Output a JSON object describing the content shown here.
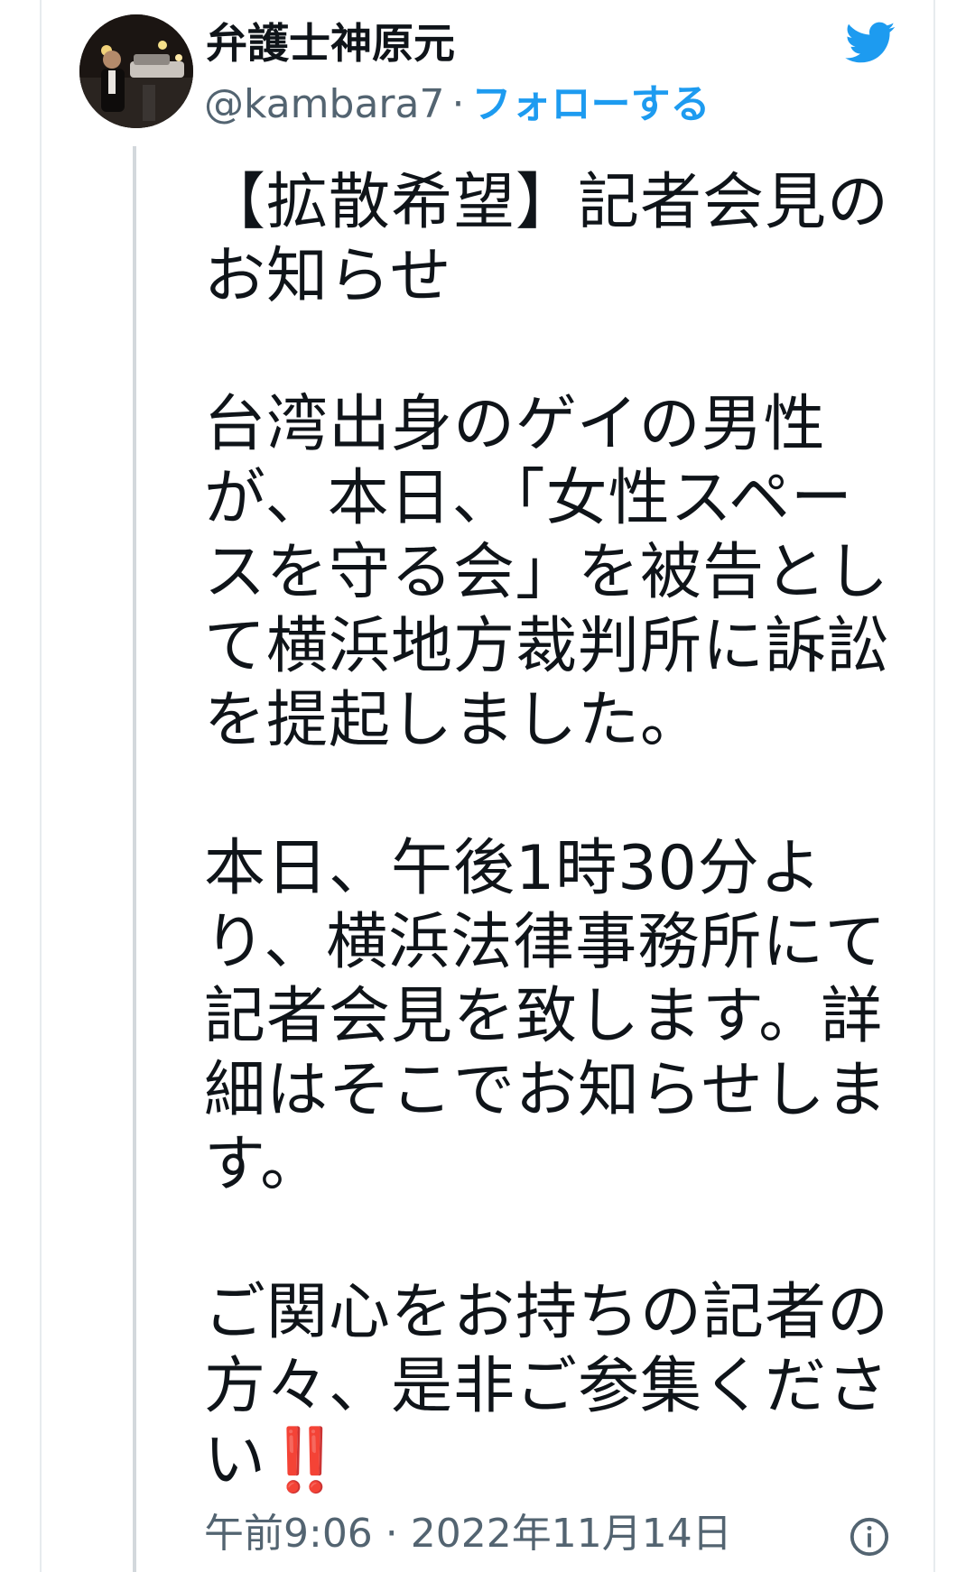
{
  "tweet": {
    "author": {
      "display_name": "弁護士神原元",
      "handle": "@kambara7",
      "separator": "·",
      "follow_label": "フォローする",
      "avatar_icon": "profile-photo"
    },
    "paragraphs": [
      "【拡散希望】記者会見のお知らせ",
      "台湾出身のゲイの男性が、本日、「女性スペースを守る会」を被告として横浜地方裁判所に訴訟を提起しました。",
      "本日、午後1時30分より、横浜法律事務所にて記者会見を致します。詳細はそこでお知らせします。",
      "ご関心をお持ちの記者の方々、是非ご参集ください"
    ],
    "closing_emoji": "‼️",
    "timestamp": "午前9:06 · 2022年11月14日"
  },
  "icons": {
    "brand": "twitter-bird-icon",
    "info": "info-icon"
  },
  "colors": {
    "accent": "#1d9bf0",
    "text": "#0f1419",
    "muted": "#536471",
    "emoji_red": "#d42a2a"
  }
}
